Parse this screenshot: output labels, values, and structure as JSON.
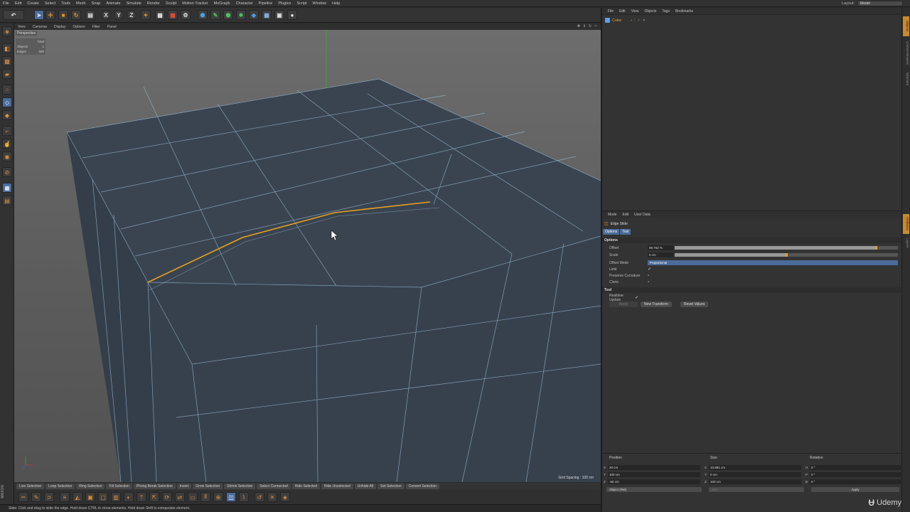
{
  "menubar": {
    "items": [
      "File",
      "Edit",
      "Create",
      "Select",
      "Tools",
      "Mesh",
      "Snap",
      "Animate",
      "Simulate",
      "Render",
      "Sculpt",
      "Motion Tracker",
      "MoGraph",
      "Character",
      "Pipeline",
      "Plugins",
      "Script",
      "Window",
      "Help"
    ],
    "layout_label": "Layout:",
    "layout_value": "Model"
  },
  "toolbar": {
    "undo_icon": "undo-icon",
    "axis_x": "X",
    "axis_y": "Y",
    "axis_z": "Z"
  },
  "viewport": {
    "menu": [
      "View",
      "Cameras",
      "Display",
      "Options",
      "Filter",
      "Panel"
    ],
    "camera_label": "Perspective",
    "stats": {
      "header": "Total",
      "rows": [
        {
          "label": "Objects",
          "value": "1"
        },
        {
          "label": "Edges",
          "value": "580"
        }
      ]
    },
    "grid_spacing": "Grid Spacing : 100 cm",
    "accent_edge_color": "#e8a020",
    "mesh_color": "#3a4450",
    "wire_color": "#9ec4e0"
  },
  "selection_bar": {
    "items": [
      "Live Selection",
      "Loop Selection",
      "Ring Selection",
      "Fill Selection",
      "Phong Break Selection",
      "Invert",
      "Grow Selection",
      "Shrink Selection",
      "Select Connected",
      "Hide Selected",
      "Hide Unselected",
      "Unhide All",
      "Set Selection",
      "Convert Selection"
    ]
  },
  "status": {
    "text": "Slide: Click and drag to slide the edge. Hold down CTRL to clone elements. Hold down Shift to extrapolate element."
  },
  "object_manager": {
    "menu": [
      "File",
      "Edit",
      "View",
      "Objects",
      "Tags",
      "Bookmarks"
    ],
    "object_name": "Cube"
  },
  "attribute_manager": {
    "menu": [
      "Mode",
      "Edit",
      "User Data"
    ],
    "tool_name": "Edge Slide",
    "tabs": [
      "Options",
      "Tool"
    ],
    "options_section": "Options",
    "fields": {
      "offset_label": "Offset",
      "offset_value": "89.762 %",
      "offset_fraction": 0.9,
      "scale_label": "Scale",
      "scale_value": "0 cm",
      "scale_fraction": 0.5,
      "offset_mode_label": "Offset Mode",
      "offset_mode_value": "Proportional",
      "limit_label": "Limit",
      "preserve_label": "Preserve Curvature",
      "clone_label": "Clone"
    },
    "tool_section": "Tool",
    "realtime_label": "Realtime Update",
    "buttons": {
      "apply": "Apply",
      "new_transform": "New Transform",
      "reset_values": "Reset Values"
    }
  },
  "coordinate_manager": {
    "headers": [
      "Position",
      "Size",
      "Rotation"
    ],
    "position": [
      {
        "axis": "X",
        "value": "20 cm"
      },
      {
        "axis": "Y",
        "value": "100 cm"
      },
      {
        "axis": "Z",
        "value": "-60 cm"
      }
    ],
    "size": [
      {
        "axis": "X",
        "value": "10.891 cm"
      },
      {
        "axis": "Y",
        "value": "0 cm"
      },
      {
        "axis": "Z",
        "value": "100 cm"
      }
    ],
    "rotation": [
      {
        "axis": "H",
        "value": "0 °"
      },
      {
        "axis": "P",
        "value": "0 °"
      },
      {
        "axis": "B",
        "value": "0 °"
      }
    ],
    "mode_select": "Object (Rel)",
    "size_select": "Size",
    "apply": "Apply"
  },
  "watermark": {
    "brand": "Udemy"
  }
}
